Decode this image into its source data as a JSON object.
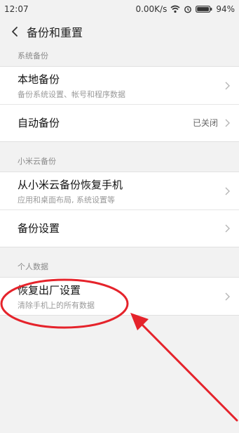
{
  "statusbar": {
    "time": "12:07",
    "speed": "0.00K/s",
    "battery": "94%"
  },
  "header": {
    "title": "备份和重置"
  },
  "sections": {
    "system": {
      "label": "系统备份",
      "local": {
        "title": "本地备份",
        "sub": "备份系统设置、帐号和程序数据"
      },
      "auto": {
        "title": "自动备份",
        "value": "已关闭"
      }
    },
    "cloud": {
      "label": "小米云备份",
      "restore": {
        "title": "从小米云备份恢复手机",
        "sub": "应用和桌面布局, 系统设置等"
      },
      "settings": {
        "title": "备份设置"
      }
    },
    "personal": {
      "label": "个人数据",
      "factory": {
        "title": "恢复出厂设置",
        "sub": "清除手机上的所有数据"
      }
    }
  },
  "annotation_color": "#e5232b"
}
